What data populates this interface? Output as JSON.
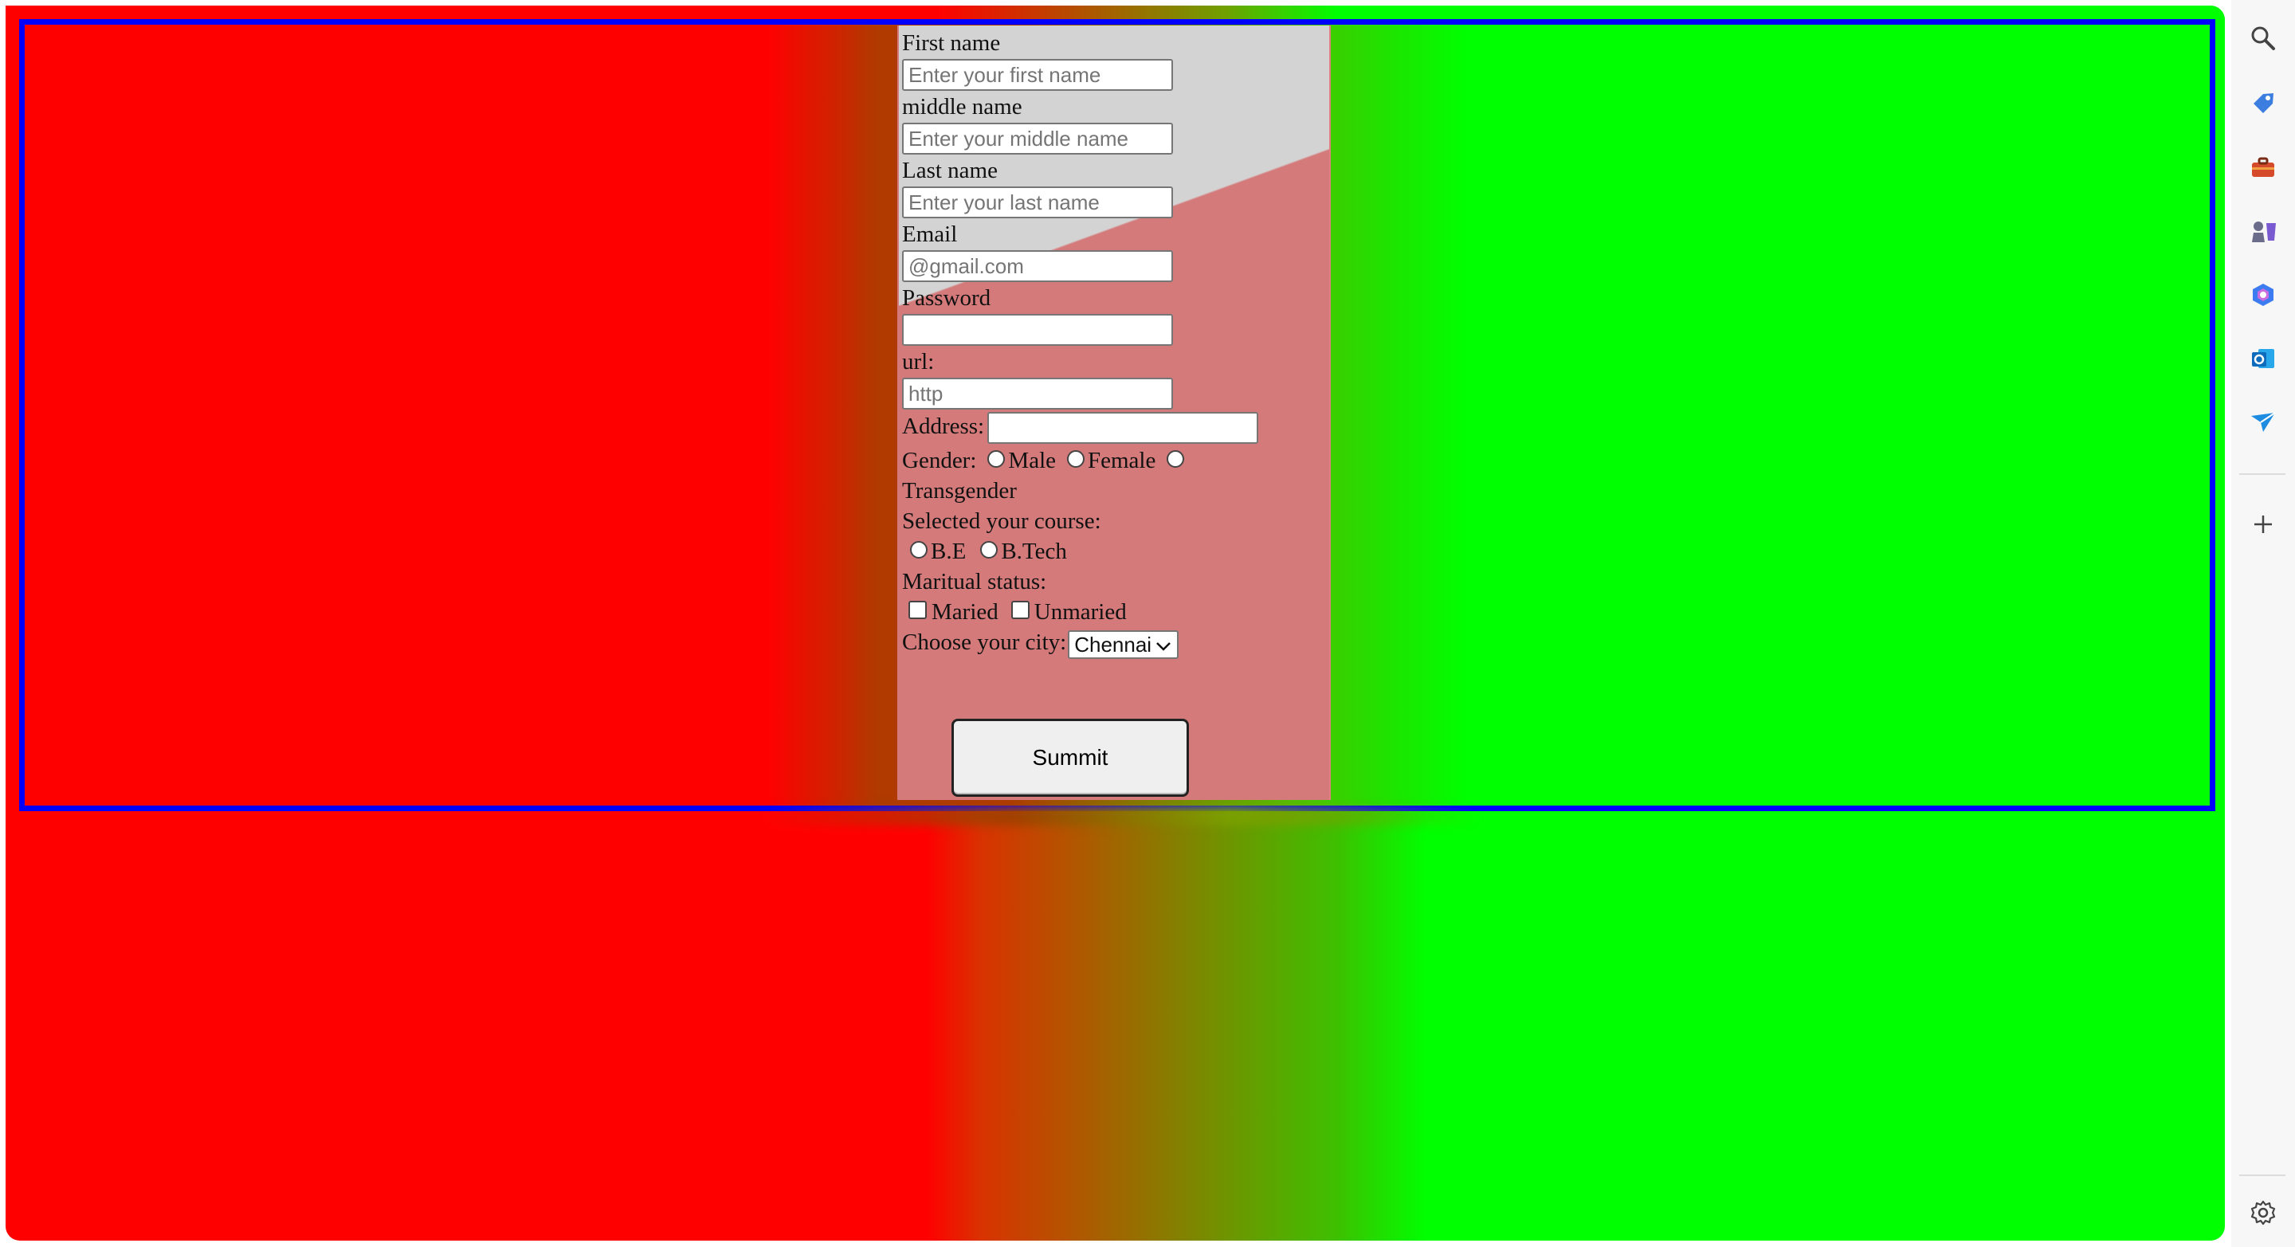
{
  "form": {
    "first_name": {
      "label": "First name",
      "placeholder": "Enter your first name"
    },
    "middle_name": {
      "label": "middle name",
      "placeholder": "Enter your middle name"
    },
    "last_name": {
      "label": "Last name",
      "placeholder": "Enter your last name"
    },
    "email": {
      "label": "Email",
      "placeholder": "@gmail.com"
    },
    "password": {
      "label": "Password",
      "placeholder": ""
    },
    "url": {
      "label": "url:",
      "placeholder": "http"
    },
    "address": {
      "label": "Address:"
    },
    "gender": {
      "label": "Gender:",
      "options": [
        "Male",
        "Female",
        "Transgender"
      ]
    },
    "course": {
      "label": "Selected your course:",
      "options": [
        "B.E",
        "B.Tech"
      ]
    },
    "marital": {
      "label": "Maritual status:",
      "options": [
        "Maried",
        "Unmaried"
      ]
    },
    "city": {
      "label": "Choose your city:",
      "selected": "Chennai"
    },
    "submit_label": "Summit"
  },
  "sidebar": {
    "icons": [
      "search-icon",
      "tag-icon",
      "toolbox-icon",
      "chess-icon",
      "copilot-icon",
      "outlook-icon",
      "send-icon",
      "add-icon",
      "settings-icon"
    ]
  },
  "colors": {
    "left": "#ff0000",
    "right": "#00ff00",
    "frame_border": "#0000ff",
    "form_bg_top": "#d4d3d4",
    "form_bg_bottom": "#d47a7a"
  }
}
